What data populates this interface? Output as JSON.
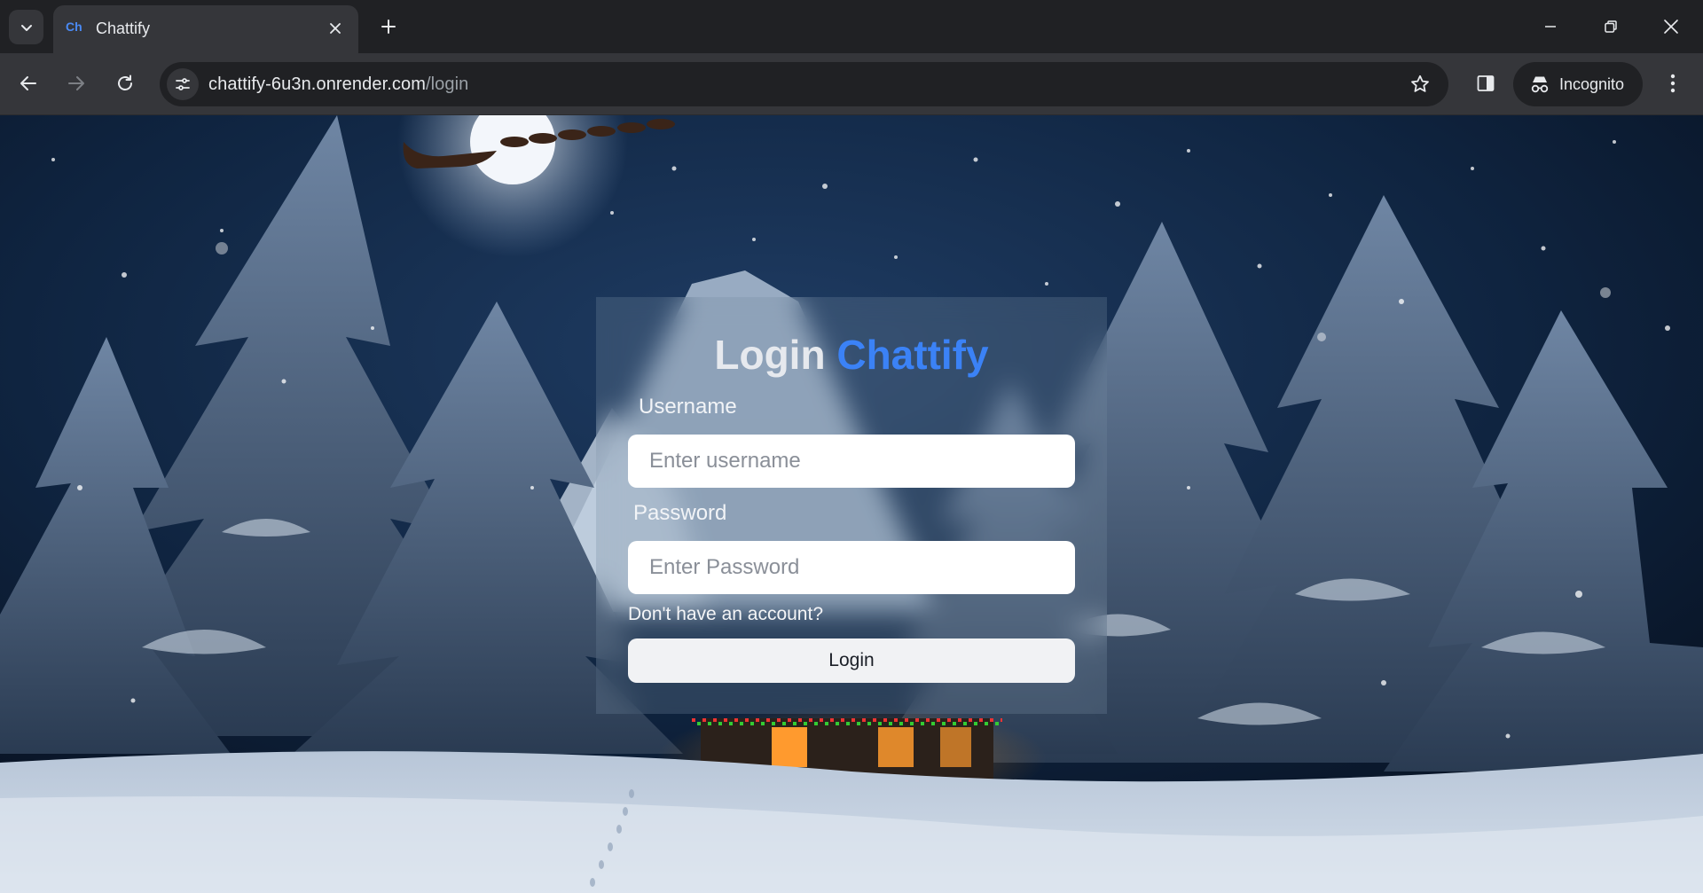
{
  "browser": {
    "tab": {
      "favicon_text": "Ch",
      "title": "Chattify"
    },
    "url": {
      "host": "chattify-6u3n.onrender.com",
      "path": "/login"
    },
    "incognito_label": "Incognito"
  },
  "login": {
    "heading_prefix": "Login",
    "heading_brand": "Chattify",
    "username_label": "Username",
    "username_placeholder": "Enter username",
    "password_label": "Password",
    "password_placeholder": "Enter Password",
    "signup_link": "Don't have an account?",
    "submit_label": "Login"
  },
  "colors": {
    "brand_blue": "#3b82f6",
    "chrome_dark": "#202124",
    "chrome_toolbar": "#35363a"
  }
}
